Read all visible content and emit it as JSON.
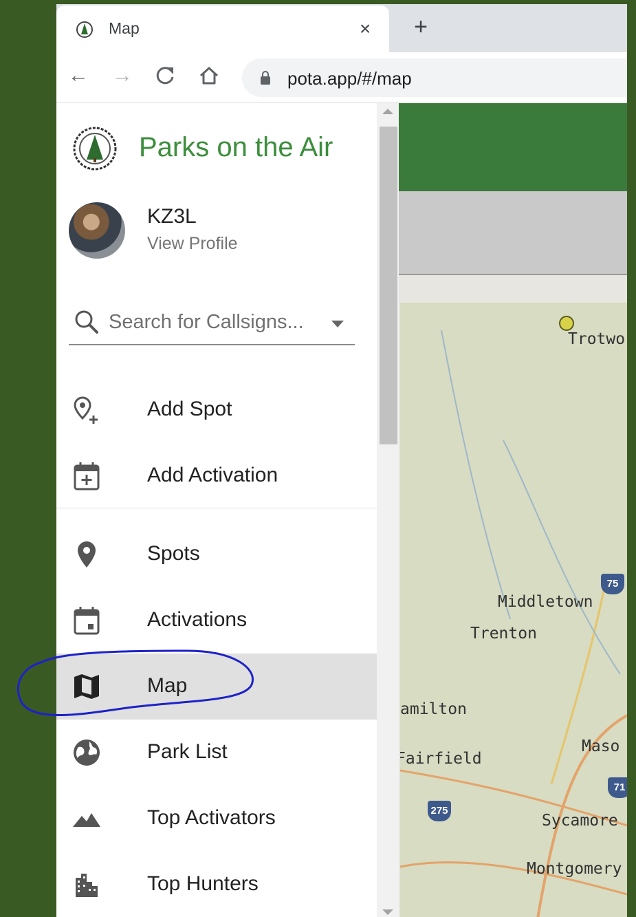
{
  "browser": {
    "tab_title": "Map",
    "tab_close": "×",
    "new_tab": "+",
    "url": "pota.app/#/map",
    "back": "←",
    "forward": "→",
    "reload": "C",
    "home": "⌂"
  },
  "app": {
    "title": "Parks on the Air",
    "brand_color": "#3c8e3c"
  },
  "profile": {
    "callsign": "KZ3L",
    "link": "View Profile"
  },
  "search": {
    "placeholder": "Search for Callsigns..."
  },
  "menu": [
    {
      "label": "Add Spot",
      "icon": "add-location-icon"
    },
    {
      "label": "Add Activation",
      "icon": "calendar-add-icon"
    },
    {
      "label": "Spots",
      "icon": "location-pin-icon"
    },
    {
      "label": "Activations",
      "icon": "calendar-icon"
    },
    {
      "label": "Map",
      "icon": "map-icon",
      "active": true
    },
    {
      "label": "Park List",
      "icon": "globe-icon"
    },
    {
      "label": "Top Activators",
      "icon": "mountains-icon"
    },
    {
      "label": "Top Hunters",
      "icon": "buildings-icon"
    }
  ],
  "map": {
    "labels": [
      "Trotwo",
      "Middletown",
      "Trenton",
      "amilton",
      "Fairfield",
      "Maso",
      "Sycamore",
      "Montgomery"
    ],
    "shields": [
      "75",
      "275",
      "71"
    ]
  }
}
